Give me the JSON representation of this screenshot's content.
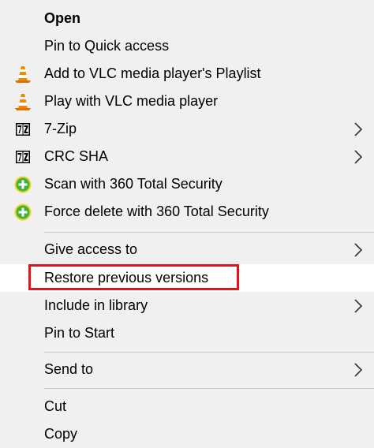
{
  "menu": {
    "items": [
      {
        "label": "Open",
        "bold": true
      },
      {
        "label": "Pin to Quick access"
      },
      {
        "label": "Add to VLC media player's Playlist",
        "icon": "vlc-cone-icon"
      },
      {
        "label": "Play with VLC media player",
        "icon": "vlc-cone-icon"
      },
      {
        "label": "7-Zip",
        "icon": "7zip-icon",
        "submenu": true
      },
      {
        "label": "CRC SHA",
        "icon": "7zip-icon",
        "submenu": true
      },
      {
        "label": "Scan with 360 Total Security",
        "icon": "360-security-icon"
      },
      {
        "label": "Force delete with 360 Total Security",
        "icon": "360-security-icon"
      },
      {
        "label": "Give access to",
        "submenu": true
      },
      {
        "label": "Restore previous versions",
        "highlighted": true
      },
      {
        "label": "Include in library",
        "submenu": true
      },
      {
        "label": "Pin to Start"
      },
      {
        "label": "Send to",
        "submenu": true
      },
      {
        "label": "Cut"
      },
      {
        "label": "Copy"
      }
    ]
  },
  "colors": {
    "background": "#f0f0f0",
    "hover": "#ffffff",
    "highlight_border": "#e0141b",
    "separator": "#c8c8c8",
    "vlc_orange": "#f08a00",
    "security_green": "#3db53d",
    "security_yellow": "#f3d21a"
  }
}
